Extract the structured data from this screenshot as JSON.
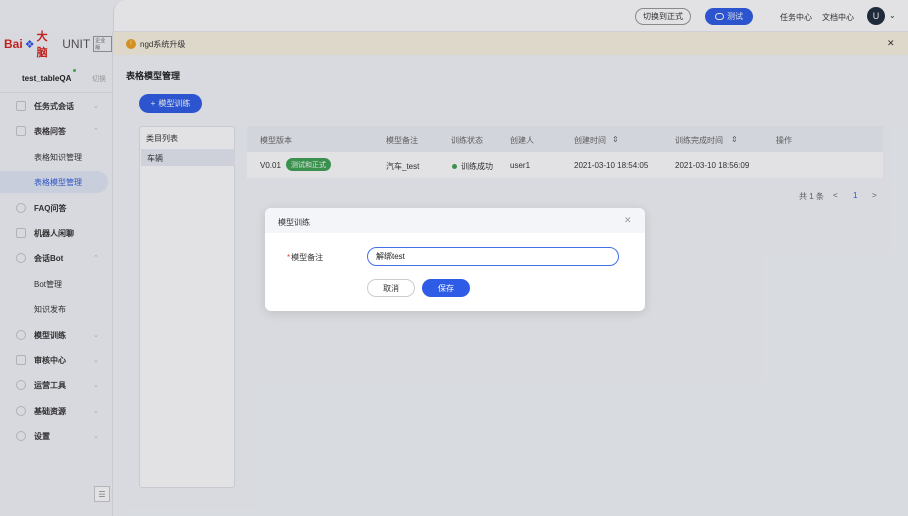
{
  "header": {
    "switch_formal": "切换到正式",
    "test": "测试",
    "task_center": "任务中心",
    "doc_center": "文档中心",
    "avatar_letter": "U"
  },
  "logo": {
    "bai": "Bai",
    "big": "大脑",
    "unit": "UNIT",
    "badge": "企业版"
  },
  "project": {
    "name": "test_tableQA",
    "switch": "切换"
  },
  "sidebar": {
    "items": [
      {
        "label": "任务式会话"
      },
      {
        "label": "表格问答"
      },
      {
        "label": "表格知识管理"
      },
      {
        "label": "表格模型管理"
      },
      {
        "label": "FAQ问答"
      },
      {
        "label": "机器人闲聊"
      },
      {
        "label": "会话Bot"
      },
      {
        "label": "Bot管理"
      },
      {
        "label": "知识发布"
      },
      {
        "label": "模型训练"
      },
      {
        "label": "审核中心"
      },
      {
        "label": "运营工具"
      },
      {
        "label": "基础资源"
      },
      {
        "label": "设置"
      }
    ]
  },
  "notice": {
    "text": "ngd系统升级"
  },
  "main": {
    "title": "表格模型管理",
    "train_button": "模型训练",
    "category": {
      "header": "类目列表",
      "items": [
        "车辆"
      ]
    },
    "table": {
      "columns": [
        "模型版本",
        "模型备注",
        "训练状态",
        "创建人",
        "创建时间",
        "训练完成时间",
        "操作"
      ],
      "rows": [
        {
          "version": "V0.01",
          "tag": "测试和正式",
          "note": "汽车_test",
          "status": "训练成功",
          "creator": "user1",
          "created": "2021-03-10 18:54:05",
          "finished": "2021-03-10 18:56:09"
        }
      ]
    },
    "pagination": {
      "total": "共 1 条",
      "page": "1"
    }
  },
  "modal": {
    "title": "模型训练",
    "field_label": "模型备注",
    "field_value": "解绑test",
    "cancel": "取消",
    "save": "保存"
  },
  "colors": {
    "primary": "#2e5ce6",
    "success": "#3ea352",
    "notice_bg": "#fbf4e3"
  }
}
